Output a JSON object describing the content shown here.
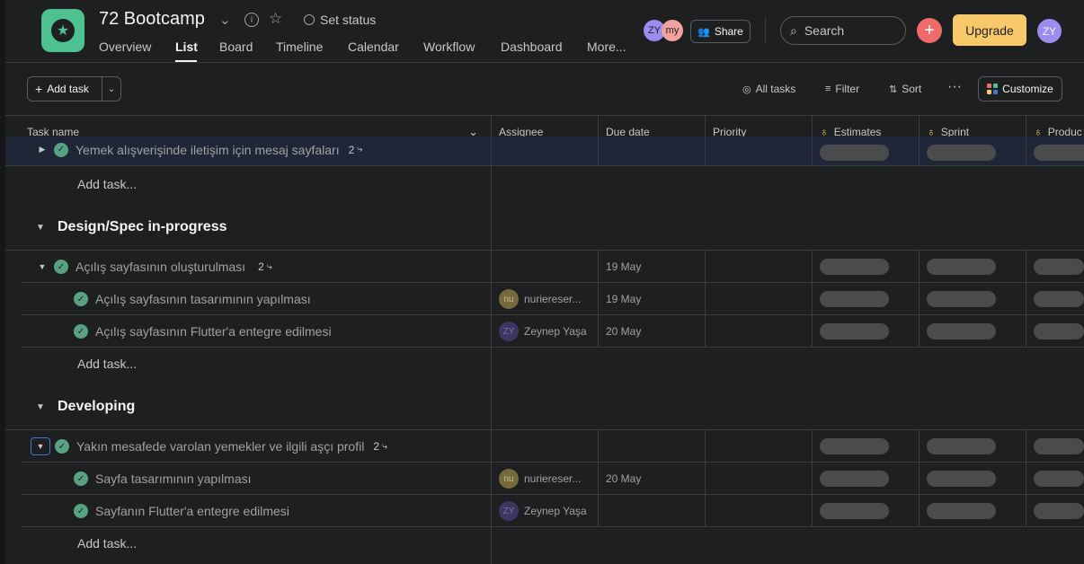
{
  "colors": {
    "app_tile": "#4ec190",
    "accent_add": "#f06a6a",
    "upgrade": "#f8c96b",
    "check": "#58a182",
    "focus": "#4573d2",
    "avatar_zy": "#9b8cf0",
    "avatar_my": "#f2a1a1"
  },
  "project": {
    "title": "72 Bootcamp",
    "set_status": "Set status",
    "icon": "star-icon"
  },
  "tabs": [
    {
      "label": "Overview"
    },
    {
      "label": "List"
    },
    {
      "label": "Board"
    },
    {
      "label": "Timeline"
    },
    {
      "label": "Calendar"
    },
    {
      "label": "Workflow"
    },
    {
      "label": "Dashboard"
    },
    {
      "label": "More..."
    }
  ],
  "active_tab": "List",
  "members": {
    "zy": "ZY",
    "my": "my"
  },
  "share_label": "Share",
  "search_placeholder": "Search",
  "upgrade_label": "Upgrade",
  "user_initials": "ZY",
  "toolbar": {
    "add_task": "Add task",
    "all_tasks": "All tasks",
    "filter": "Filter",
    "sort": "Sort",
    "customize": "Customize"
  },
  "columns": {
    "task_name": "Task name",
    "assignee": "Assignee",
    "due_date": "Due date",
    "priority": "Priority",
    "estimates": "Estimates",
    "sprint": "Sprint",
    "product": "Produc"
  },
  "add_task_row": "Add task...",
  "rows": {
    "r0": {
      "name": "Yemek alışverişinde iletişim için mesaj sayfaları",
      "subtasks": "2"
    },
    "sec1": {
      "title": "Design/Spec in-progress"
    },
    "r1": {
      "name": "Açılış sayfasının oluşturulması",
      "subtasks": "2",
      "due": "19 May"
    },
    "r2": {
      "name": "Açılış sayfasının tasarımının yapılması",
      "assignee": "nuriereser...",
      "initials": "nu",
      "due": "19 May"
    },
    "r3": {
      "name": "Açılış sayfasının Flutter'a entegre edilmesi",
      "assignee": "Zeynep Yaşa",
      "initials": "ZY",
      "due": "20 May"
    },
    "sec2": {
      "title": "Developing"
    },
    "r4": {
      "name": "Yakın mesafede varolan yemekler ve ilgili aşçı profil",
      "subtasks": "2"
    },
    "r5": {
      "name": "Sayfa tasarımının yapılması",
      "assignee": "nuriereser...",
      "initials": "nu",
      "due": "20 May"
    },
    "r6": {
      "name": "Sayfanın Flutter'a entegre edilmesi",
      "assignee": "Zeynep Yaşa",
      "initials": "ZY"
    }
  }
}
